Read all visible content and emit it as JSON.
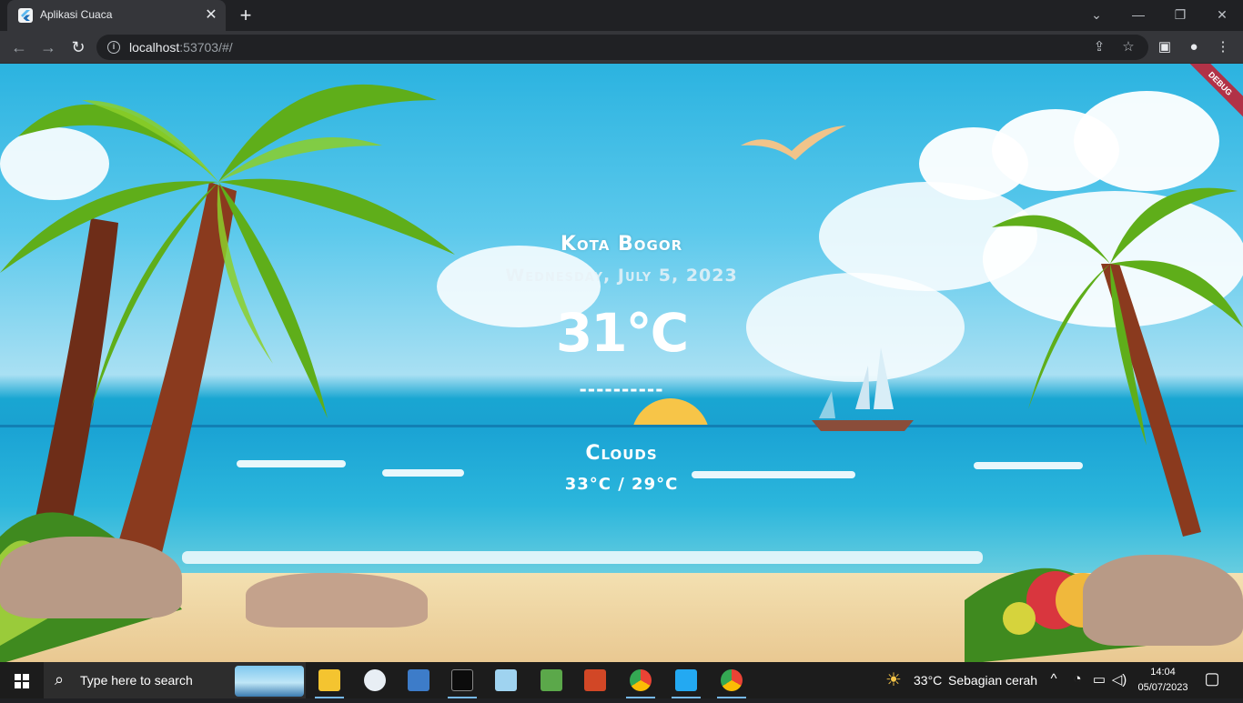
{
  "browser": {
    "tab_title": "Aplikasi Cuaca",
    "url_host": "localhost",
    "url_rest": ":53703/#/"
  },
  "app": {
    "debug_label": "DEBUG",
    "city": "Kota Bogor",
    "date": "Wednesday, July 5, 2023",
    "temperature": "31°C",
    "divider": "----------",
    "condition": "Clouds",
    "temp_range": "33°C / 29°C"
  },
  "taskbar": {
    "search_placeholder": "Type here to search",
    "weather_temp": "33°C",
    "weather_desc": "Sebagian cerah",
    "time": "14:04",
    "date": "05/07/2023",
    "apps": [
      "file-explorer",
      "paint",
      "control-panel",
      "terminal",
      "notepad",
      "snipping-tool",
      "powerpoint",
      "chrome-profile",
      "vscode",
      "chrome"
    ]
  },
  "colors": {
    "sky": "#2bb3e0",
    "sea": "#1aa3d4",
    "sand": "#e9c891",
    "debug": "#b13247",
    "taskbar": "#1c1c1c",
    "chrome": "#35363a"
  }
}
